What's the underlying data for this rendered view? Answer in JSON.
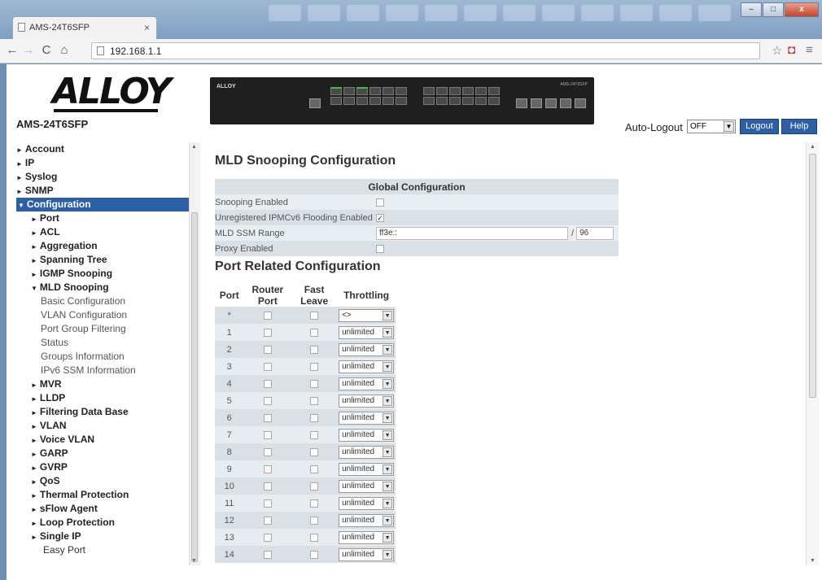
{
  "browser": {
    "tab_title": "AMS-24T6SFP",
    "tab_close": "×",
    "url": "192.168.1.1",
    "win_minimize": "–",
    "win_maximize": "□",
    "win_close": "x"
  },
  "header": {
    "logo_text": "ALLOY",
    "model": "AMS-24T6SFP",
    "switch_label": "ALLOY",
    "switch_model": "AMS-24T6SFP",
    "auto_logout_label": "Auto-Logout",
    "auto_logout_value": "OFF",
    "logout_label": "Logout",
    "help_label": "Help"
  },
  "sidebar": {
    "items": [
      {
        "label": "Account",
        "level": "l1",
        "tri": "►"
      },
      {
        "label": "IP",
        "level": "l1",
        "tri": "►"
      },
      {
        "label": "Syslog",
        "level": "l1",
        "tri": "►"
      },
      {
        "label": "SNMP",
        "level": "l1",
        "tri": "►"
      },
      {
        "label": "Configuration",
        "level": "l0",
        "tri": "▼"
      },
      {
        "label": "Port",
        "level": "l2",
        "tri": "►"
      },
      {
        "label": "ACL",
        "level": "l2",
        "tri": "►"
      },
      {
        "label": "Aggregation",
        "level": "l2",
        "tri": "►"
      },
      {
        "label": "Spanning Tree",
        "level": "l2",
        "tri": "►"
      },
      {
        "label": "IGMP Snooping",
        "level": "l2",
        "tri": "►"
      },
      {
        "label": "MLD Snooping",
        "level": "l2",
        "tri": "▼"
      },
      {
        "label": "Basic Configuration",
        "level": "l3",
        "tri": ""
      },
      {
        "label": "VLAN Configuration",
        "level": "l3",
        "tri": ""
      },
      {
        "label": "Port Group Filtering",
        "level": "l3",
        "tri": ""
      },
      {
        "label": "Status",
        "level": "l3",
        "tri": ""
      },
      {
        "label": "Groups Information",
        "level": "l3",
        "tri": ""
      },
      {
        "label": "IPv6 SSM Information",
        "level": "l3",
        "tri": ""
      },
      {
        "label": "MVR",
        "level": "l2",
        "tri": "►"
      },
      {
        "label": "LLDP",
        "level": "l2",
        "tri": "►"
      },
      {
        "label": "Filtering Data Base",
        "level": "l2",
        "tri": "►"
      },
      {
        "label": "VLAN",
        "level": "l2",
        "tri": "►"
      },
      {
        "label": "Voice VLAN",
        "level": "l2",
        "tri": "►"
      },
      {
        "label": "GARP",
        "level": "l2",
        "tri": "►"
      },
      {
        "label": "GVRP",
        "level": "l2",
        "tri": "►"
      },
      {
        "label": "QoS",
        "level": "l2",
        "tri": "►"
      },
      {
        "label": "Thermal Protection",
        "level": "l2",
        "tri": "►"
      },
      {
        "label": "sFlow Agent",
        "level": "l2",
        "tri": "►"
      },
      {
        "label": "Loop Protection",
        "level": "l2",
        "tri": "►"
      },
      {
        "label": "Single IP",
        "level": "l2",
        "tri": "►"
      },
      {
        "label": "Easy Port",
        "level": "easy",
        "tri": ""
      }
    ]
  },
  "main": {
    "title": "MLD Snooping Configuration",
    "global_header": "Global Configuration",
    "snooping_enabled_label": "Snooping Enabled",
    "snooping_enabled_checked": false,
    "unreg_flooding_label": "Unregistered IPMCv6 Flooding Enabled",
    "unreg_flooding_checked": true,
    "ssm_range_label": "MLD SSM Range",
    "ssm_range_prefix": "ff3e::",
    "ssm_range_sep": "/",
    "ssm_range_len": "96",
    "proxy_label": "Proxy Enabled",
    "proxy_checked": false,
    "port_title": "Port Related Configuration",
    "port_columns": [
      "Port",
      "Router Port",
      "Fast Leave",
      "Throttling"
    ],
    "port_rows": [
      {
        "port": "*",
        "throttling": "<>"
      },
      {
        "port": "1",
        "throttling": "unlimited"
      },
      {
        "port": "2",
        "throttling": "unlimited"
      },
      {
        "port": "3",
        "throttling": "unlimited"
      },
      {
        "port": "4",
        "throttling": "unlimited"
      },
      {
        "port": "5",
        "throttling": "unlimited"
      },
      {
        "port": "6",
        "throttling": "unlimited"
      },
      {
        "port": "7",
        "throttling": "unlimited"
      },
      {
        "port": "8",
        "throttling": "unlimited"
      },
      {
        "port": "9",
        "throttling": "unlimited"
      },
      {
        "port": "10",
        "throttling": "unlimited"
      },
      {
        "port": "11",
        "throttling": "unlimited"
      },
      {
        "port": "12",
        "throttling": "unlimited"
      },
      {
        "port": "13",
        "throttling": "unlimited"
      },
      {
        "port": "14",
        "throttling": "unlimited"
      }
    ]
  },
  "colors": {
    "accent": "#2d5fa8",
    "row_dark": "#d9e1e6",
    "row_light": "#e6ecef"
  }
}
